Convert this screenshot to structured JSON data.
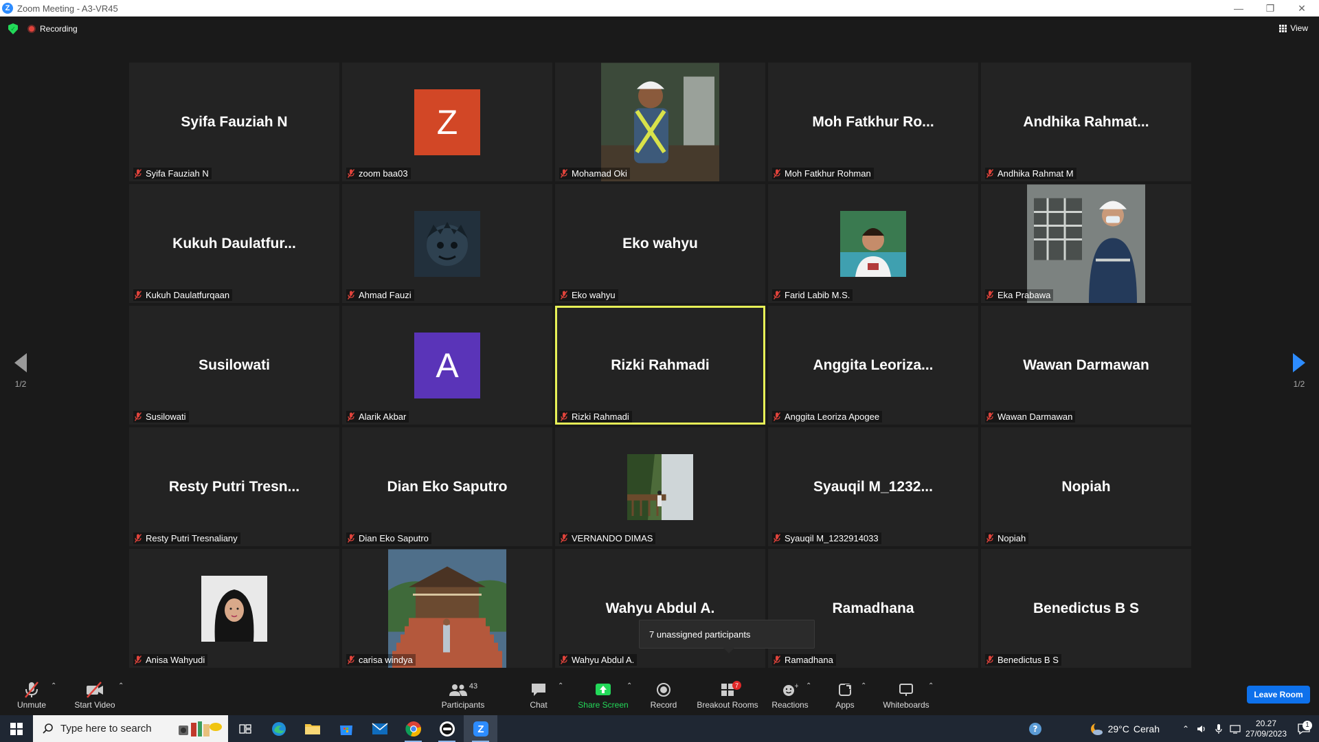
{
  "window": {
    "title": "Zoom Meeting - A3-VR45"
  },
  "topbar": {
    "recording_label": "Recording",
    "view_label": "View"
  },
  "pager": {
    "left_page": "1/2",
    "right_page": "1/2"
  },
  "participants": [
    {
      "display": "Syifa Fauziah N",
      "name": "Syifa Fauziah N",
      "kind": "name"
    },
    {
      "display": "Z",
      "name": "zoom baa03",
      "kind": "avatar",
      "color": "#d24726"
    },
    {
      "display": "",
      "name": "Mohamad Oki",
      "kind": "photo-worker"
    },
    {
      "display": "Moh  Fatkhur  Ro...",
      "name": "Moh Fatkhur Rohman",
      "kind": "name"
    },
    {
      "display": "Andhika  Rahmat...",
      "name": "Andhika Rahmat M",
      "kind": "name"
    },
    {
      "display": "Kukuh  Daulatfur...",
      "name": "Kukuh Daulatfurqaan",
      "kind": "name"
    },
    {
      "display": "",
      "name": "Ahmad Fauzi",
      "kind": "photo-anime"
    },
    {
      "display": "Eko wahyu",
      "name": "Eko wahyu",
      "kind": "name"
    },
    {
      "display": "",
      "name": "Farid Labib M.S.",
      "kind": "photo-portrait"
    },
    {
      "display": "",
      "name": "Eka Prabawa",
      "kind": "photo-helmet"
    },
    {
      "display": "Susilowati",
      "name": "Susilowati",
      "kind": "name"
    },
    {
      "display": "A",
      "name": "Alarik Akbar",
      "kind": "avatar",
      "color": "#5a34b8"
    },
    {
      "display": "Rizki Rahmadi",
      "name": "Rizki Rahmadi",
      "kind": "name",
      "active": true
    },
    {
      "display": "Anggita  Leoriza...",
      "name": "Anggita Leoriza Apogee",
      "kind": "name"
    },
    {
      "display": "Wawan Darmawan",
      "name": "Wawan Darmawan",
      "kind": "name"
    },
    {
      "display": "Resty Putri Tresn...",
      "name": "Resty Putri Tresnaliany",
      "kind": "name"
    },
    {
      "display": "Dian Eko Saputro",
      "name": "Dian Eko Saputro",
      "kind": "name"
    },
    {
      "display": "",
      "name": "VERNANDO DIMAS",
      "kind": "photo-garden"
    },
    {
      "display": "Syauqil  M_1232...",
      "name": "Syauqil M_1232914033",
      "kind": "name"
    },
    {
      "display": "Nopiah",
      "name": "Nopiah",
      "kind": "name"
    },
    {
      "display": "",
      "name": "Anisa Wahyudi",
      "kind": "photo-hijab"
    },
    {
      "display": "",
      "name": "carisa windya",
      "kind": "photo-pavilion"
    },
    {
      "display": "Wahyu Abdul A.",
      "name": "Wahyu Abdul A.",
      "kind": "name"
    },
    {
      "display": "Ramadhana",
      "name": "Ramadhana",
      "kind": "name"
    },
    {
      "display": "Benedictus B S",
      "name": "Benedictus B S",
      "kind": "name"
    }
  ],
  "tooltip": {
    "text": "7 unassigned participants"
  },
  "toolbar": {
    "unmute": "Unmute",
    "start_video": "Start Video",
    "participants": "Participants",
    "participants_count": "43",
    "chat": "Chat",
    "share_screen": "Share Screen",
    "record": "Record",
    "breakout_rooms": "Breakout Rooms",
    "breakout_badge": "7",
    "reactions": "Reactions",
    "apps": "Apps",
    "whiteboards": "Whiteboards",
    "leave": "Leave Room"
  },
  "taskbar": {
    "search_placeholder": "Type here to search",
    "weather_temp": "29°C",
    "weather_text": "Cerah",
    "time": "20.27",
    "date": "27/09/2023",
    "notification_count": "1"
  },
  "colors": {
    "accent": "#2d8cff",
    "active_speaker": "#e7f157",
    "muted": "#e0433b",
    "leave": "#0e71eb"
  }
}
